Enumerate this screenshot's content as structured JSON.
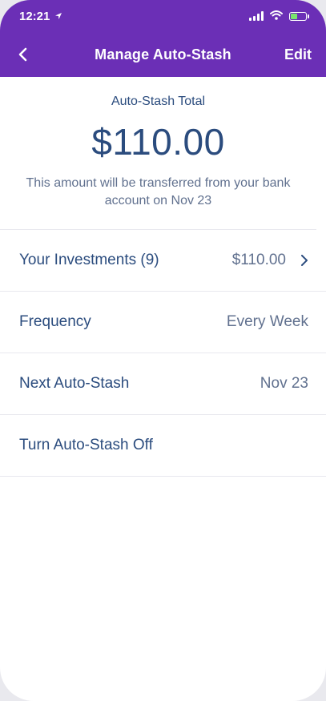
{
  "status_bar": {
    "time": "12:21"
  },
  "nav": {
    "title": "Manage Auto-Stash",
    "edit_label": "Edit"
  },
  "summary": {
    "label": "Auto-Stash Total",
    "amount": "$110.00",
    "note": "This amount will be transferred from your bank account on Nov 23"
  },
  "rows": [
    {
      "label": "Your Investments (9)",
      "value": "$110.00"
    },
    {
      "label": "Frequency",
      "value": "Every Week"
    },
    {
      "label": "Next Auto-Stash",
      "value": "Nov 23"
    },
    {
      "label": "Turn Auto-Stash Off",
      "value": ""
    }
  ],
  "colors": {
    "header_bg": "#6b2fb6",
    "primary_text": "#2b4c7e",
    "secondary_text": "#61718f",
    "battery_fill": "#7ae36f"
  },
  "icons": {
    "back": "chevron-left-icon",
    "row_chevron": "chevron-right-icon",
    "location": "location-arrow-icon",
    "signal": "cellular-signal-icon",
    "wifi": "wifi-icon",
    "battery": "battery-charging-icon"
  }
}
